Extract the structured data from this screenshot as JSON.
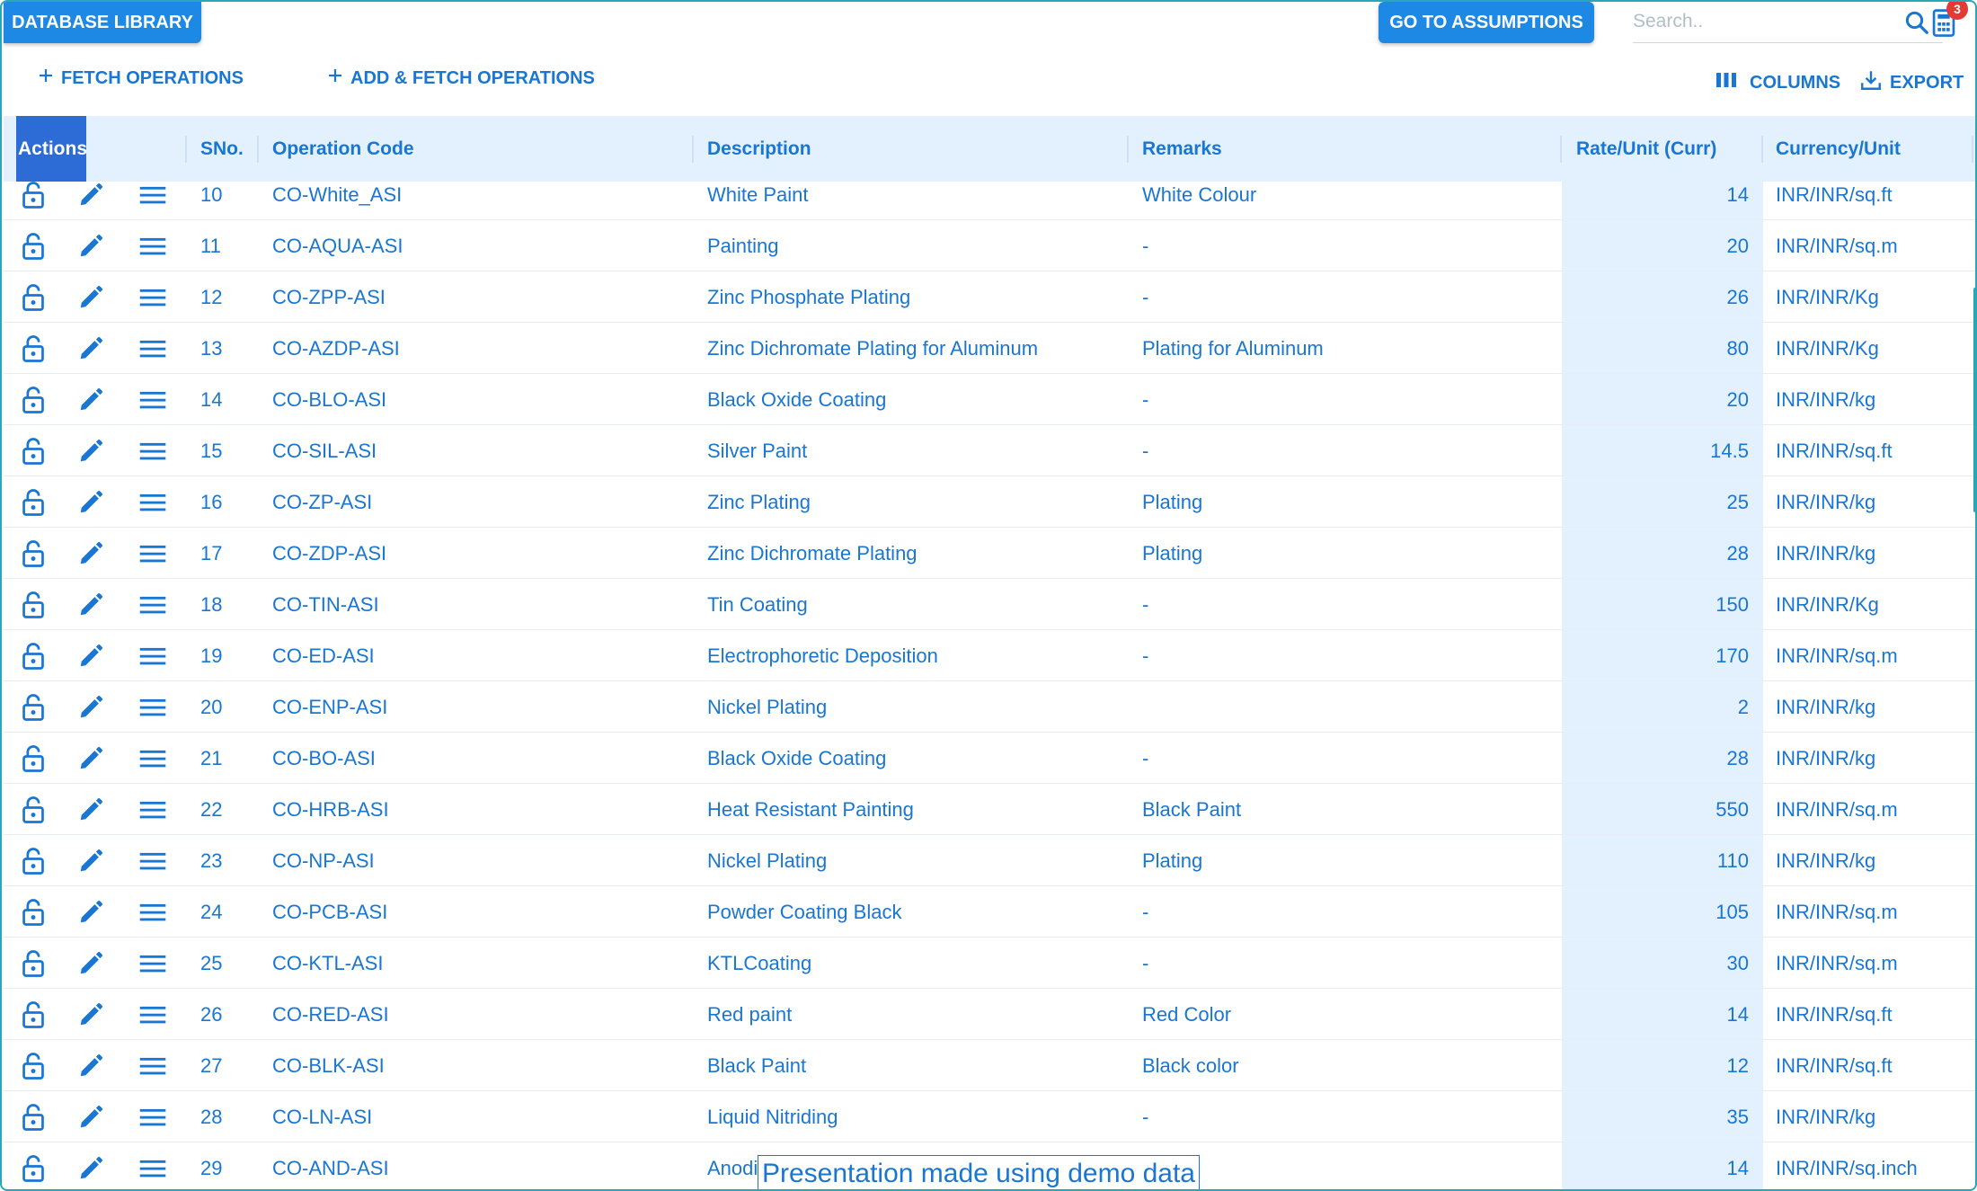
{
  "topbar": {
    "database_library": "DATABASE LIBRARY",
    "go_to_assumptions": "GO TO ASSUMPTIONS",
    "search_placeholder": "Search..",
    "cart_badge": "3"
  },
  "toolbar": {
    "fetch_operations": "FETCH OPERATIONS",
    "add_fetch_operations": "ADD & FETCH OPERATIONS",
    "columns": "COLUMNS",
    "export": "EXPORT"
  },
  "table": {
    "headers": {
      "actions": "Actions",
      "sno": "SNo.",
      "operation_code": "Operation Code",
      "description": "Description",
      "remarks": "Remarks",
      "rate_unit": "Rate/Unit (Curr)",
      "currency_unit": "Currency/Unit"
    },
    "rows": [
      {
        "sno": "10",
        "code": "CO-White_ASI",
        "desc": "White Paint",
        "remarks": "White Colour",
        "rate": "14",
        "currency": "INR/INR/sq.ft"
      },
      {
        "sno": "11",
        "code": "CO-AQUA-ASI",
        "desc": "Painting",
        "remarks": "-",
        "rate": "20",
        "currency": "INR/INR/sq.m"
      },
      {
        "sno": "12",
        "code": "CO-ZPP-ASI",
        "desc": "Zinc Phosphate Plating",
        "remarks": "-",
        "rate": "26",
        "currency": "INR/INR/Kg"
      },
      {
        "sno": "13",
        "code": "CO-AZDP-ASI",
        "desc": "Zinc Dichromate Plating for Aluminum",
        "remarks": "Plating for Aluminum",
        "rate": "80",
        "currency": "INR/INR/Kg"
      },
      {
        "sno": "14",
        "code": "CO-BLO-ASI",
        "desc": "Black Oxide Coating",
        "remarks": "-",
        "rate": "20",
        "currency": "INR/INR/kg"
      },
      {
        "sno": "15",
        "code": "CO-SIL-ASI",
        "desc": "Silver Paint",
        "remarks": "-",
        "rate": "14.5",
        "currency": "INR/INR/sq.ft"
      },
      {
        "sno": "16",
        "code": "CO-ZP-ASI",
        "desc": "Zinc Plating",
        "remarks": "Plating",
        "rate": "25",
        "currency": "INR/INR/kg"
      },
      {
        "sno": "17",
        "code": "CO-ZDP-ASI",
        "desc": "Zinc Dichromate Plating",
        "remarks": "Plating",
        "rate": "28",
        "currency": "INR/INR/kg"
      },
      {
        "sno": "18",
        "code": "CO-TIN-ASI",
        "desc": "Tin Coating",
        "remarks": "-",
        "rate": "150",
        "currency": "INR/INR/Kg"
      },
      {
        "sno": "19",
        "code": "CO-ED-ASI",
        "desc": "Electrophoretic Deposition",
        "remarks": "-",
        "rate": "170",
        "currency": "INR/INR/sq.m"
      },
      {
        "sno": "20",
        "code": "CO-ENP-ASI",
        "desc": "Nickel Plating",
        "remarks": "",
        "rate": "2",
        "currency": "INR/INR/kg"
      },
      {
        "sno": "21",
        "code": "CO-BO-ASI",
        "desc": "Black Oxide Coating",
        "remarks": "-",
        "rate": "28",
        "currency": "INR/INR/kg"
      },
      {
        "sno": "22",
        "code": "CO-HRB-ASI",
        "desc": "Heat Resistant Painting",
        "remarks": "Black Paint",
        "rate": "550",
        "currency": "INR/INR/sq.m"
      },
      {
        "sno": "23",
        "code": "CO-NP-ASI",
        "desc": "Nickel Plating",
        "remarks": "Plating",
        "rate": "110",
        "currency": "INR/INR/kg"
      },
      {
        "sno": "24",
        "code": "CO-PCB-ASI",
        "desc": "Powder Coating Black",
        "remarks": "-",
        "rate": "105",
        "currency": "INR/INR/sq.m"
      },
      {
        "sno": "25",
        "code": "CO-KTL-ASI",
        "desc": "KTLCoating",
        "remarks": "-",
        "rate": "30",
        "currency": "INR/INR/sq.m"
      },
      {
        "sno": "26",
        "code": "CO-RED-ASI",
        "desc": "Red paint",
        "remarks": "Red Color",
        "rate": "14",
        "currency": "INR/INR/sq.ft"
      },
      {
        "sno": "27",
        "code": "CO-BLK-ASI",
        "desc": "Black Paint",
        "remarks": "Black color",
        "rate": "12",
        "currency": "INR/INR/sq.ft"
      },
      {
        "sno": "28",
        "code": "CO-LN-ASI",
        "desc": "Liquid Nitriding",
        "remarks": "-",
        "rate": "35",
        "currency": "INR/INR/kg"
      },
      {
        "sno": "29",
        "code": "CO-AND-ASI",
        "desc": "Anodi",
        "remarks": "",
        "rate": "14",
        "currency": "INR/INR/sq.inch"
      }
    ]
  },
  "watermark": "Presentation made using demo data",
  "colors": {
    "primary": "#1e88e5",
    "text": "#1976d2",
    "header_bg": "#e3f0fd",
    "actions_header": "#2d6bd6",
    "badge": "#e53935",
    "frame": "#2aa6b8"
  }
}
